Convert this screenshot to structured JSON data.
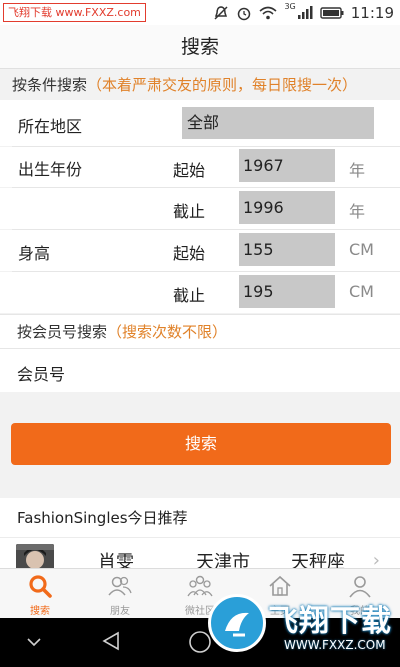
{
  "status_bar": {
    "watermark": "飞翔下载 www.FXXZ.com",
    "signal_label": "3G",
    "time": "11:19"
  },
  "header": {
    "title": "搜索"
  },
  "condition_search": {
    "heading": "按条件搜索",
    "note": "（本着严肃交友的原则，每日限搜一次）",
    "location": {
      "label": "所在地区",
      "value": "全部"
    },
    "birth_year": {
      "label": "出生年份",
      "start_label": "起始",
      "start_value": "1967",
      "end_label": "截止",
      "end_value": "1996",
      "unit": "年"
    },
    "height": {
      "label": "身高",
      "start_label": "起始",
      "start_value": "155",
      "end_label": "截止",
      "end_value": "195",
      "unit": "CM"
    }
  },
  "member_search": {
    "heading": "按会员号搜索",
    "note": "（搜索次数不限）",
    "label": "会员号"
  },
  "search_button": "搜索",
  "recommend": {
    "heading": "FashionSingles今日推荐",
    "first": {
      "name": "肖雯",
      "city": "天津市",
      "sign": "天秤座"
    }
  },
  "tabbar": [
    {
      "label": "搜索",
      "active": true
    },
    {
      "label": "朋友",
      "active": false
    },
    {
      "label": "微社区",
      "active": false
    },
    {
      "label": "主页",
      "active": false
    },
    {
      "label": "我的",
      "active": false
    }
  ],
  "watermark_logo": {
    "main": "飞翔下载",
    "url": "WWW.FXXZ.COM"
  },
  "colors": {
    "accent": "#f16a1a",
    "note": "#e0822a",
    "input_bg": "#c8c8c8"
  }
}
